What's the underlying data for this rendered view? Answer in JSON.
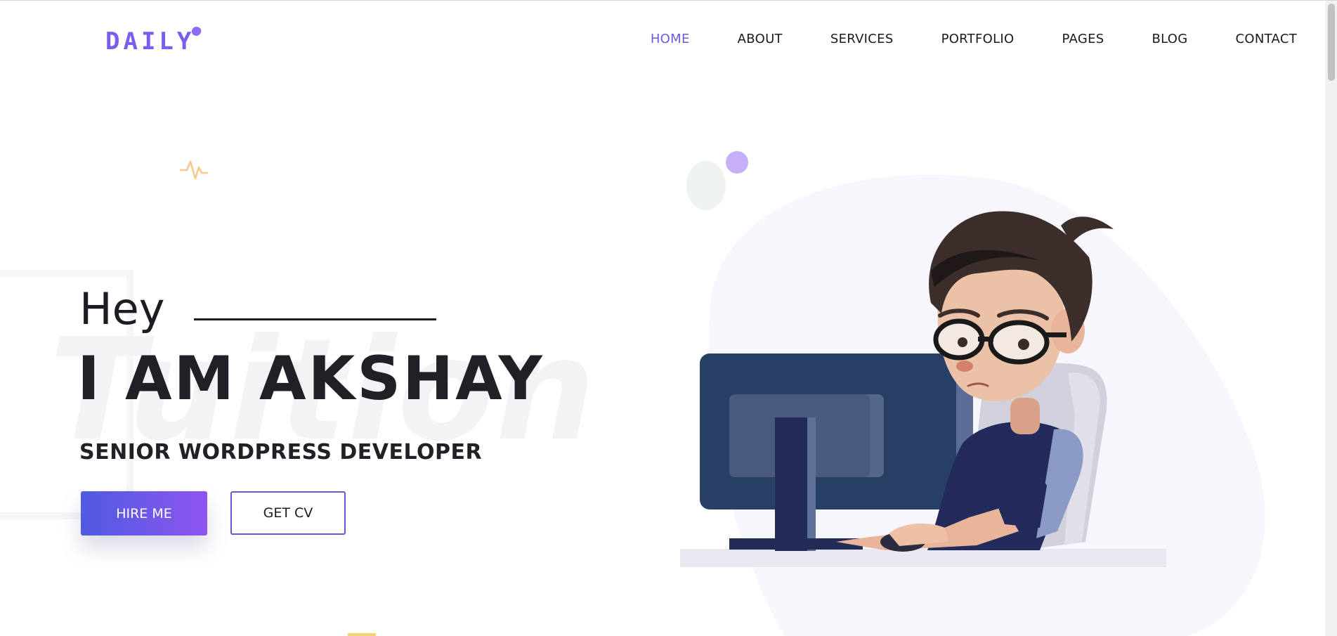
{
  "header": {
    "logo_text": "DAILY",
    "nav": [
      {
        "label": "HOME",
        "active": true
      },
      {
        "label": "ABOUT",
        "active": false
      },
      {
        "label": "SERVICES",
        "active": false
      },
      {
        "label": "PORTFOLIO",
        "active": false
      },
      {
        "label": "PAGES",
        "active": false
      },
      {
        "label": "BLOG",
        "active": false
      },
      {
        "label": "CONTACT",
        "active": false
      }
    ]
  },
  "hero": {
    "greeting": "Hey",
    "name": "I AM AKSHAY",
    "role": "SENIOR WORDPRESS DEVELOPER",
    "watermark": "Tuition",
    "hire_button": "HIRE ME",
    "cv_button": "GET CV",
    "illustration": "developer-at-computer-illustration"
  },
  "colors": {
    "accent": "#6a5bd8",
    "gradient_start": "#4f5be0",
    "gradient_end": "#8e55f0",
    "text_dark": "#202126"
  },
  "icons": [
    "logo-dot-icon",
    "pulse-icon"
  ]
}
